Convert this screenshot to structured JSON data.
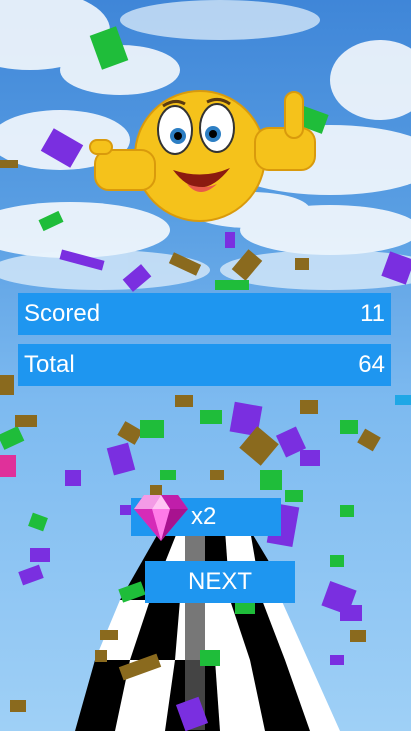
{
  "score": {
    "scored_label": "Scored",
    "scored_value": "11",
    "total_label": "Total",
    "total_value": "64"
  },
  "multiplier": {
    "label": "x2"
  },
  "next_button": {
    "label": "NEXT"
  },
  "colors": {
    "panel": "#1e96f0",
    "confetti": [
      "#1fbd3a",
      "#7a2fe0",
      "#8a6a1e",
      "#1fa7e6",
      "#e0309a"
    ]
  },
  "icons": [
    "thumbs-up-emoji-icon",
    "diamond-gem-icon"
  ]
}
